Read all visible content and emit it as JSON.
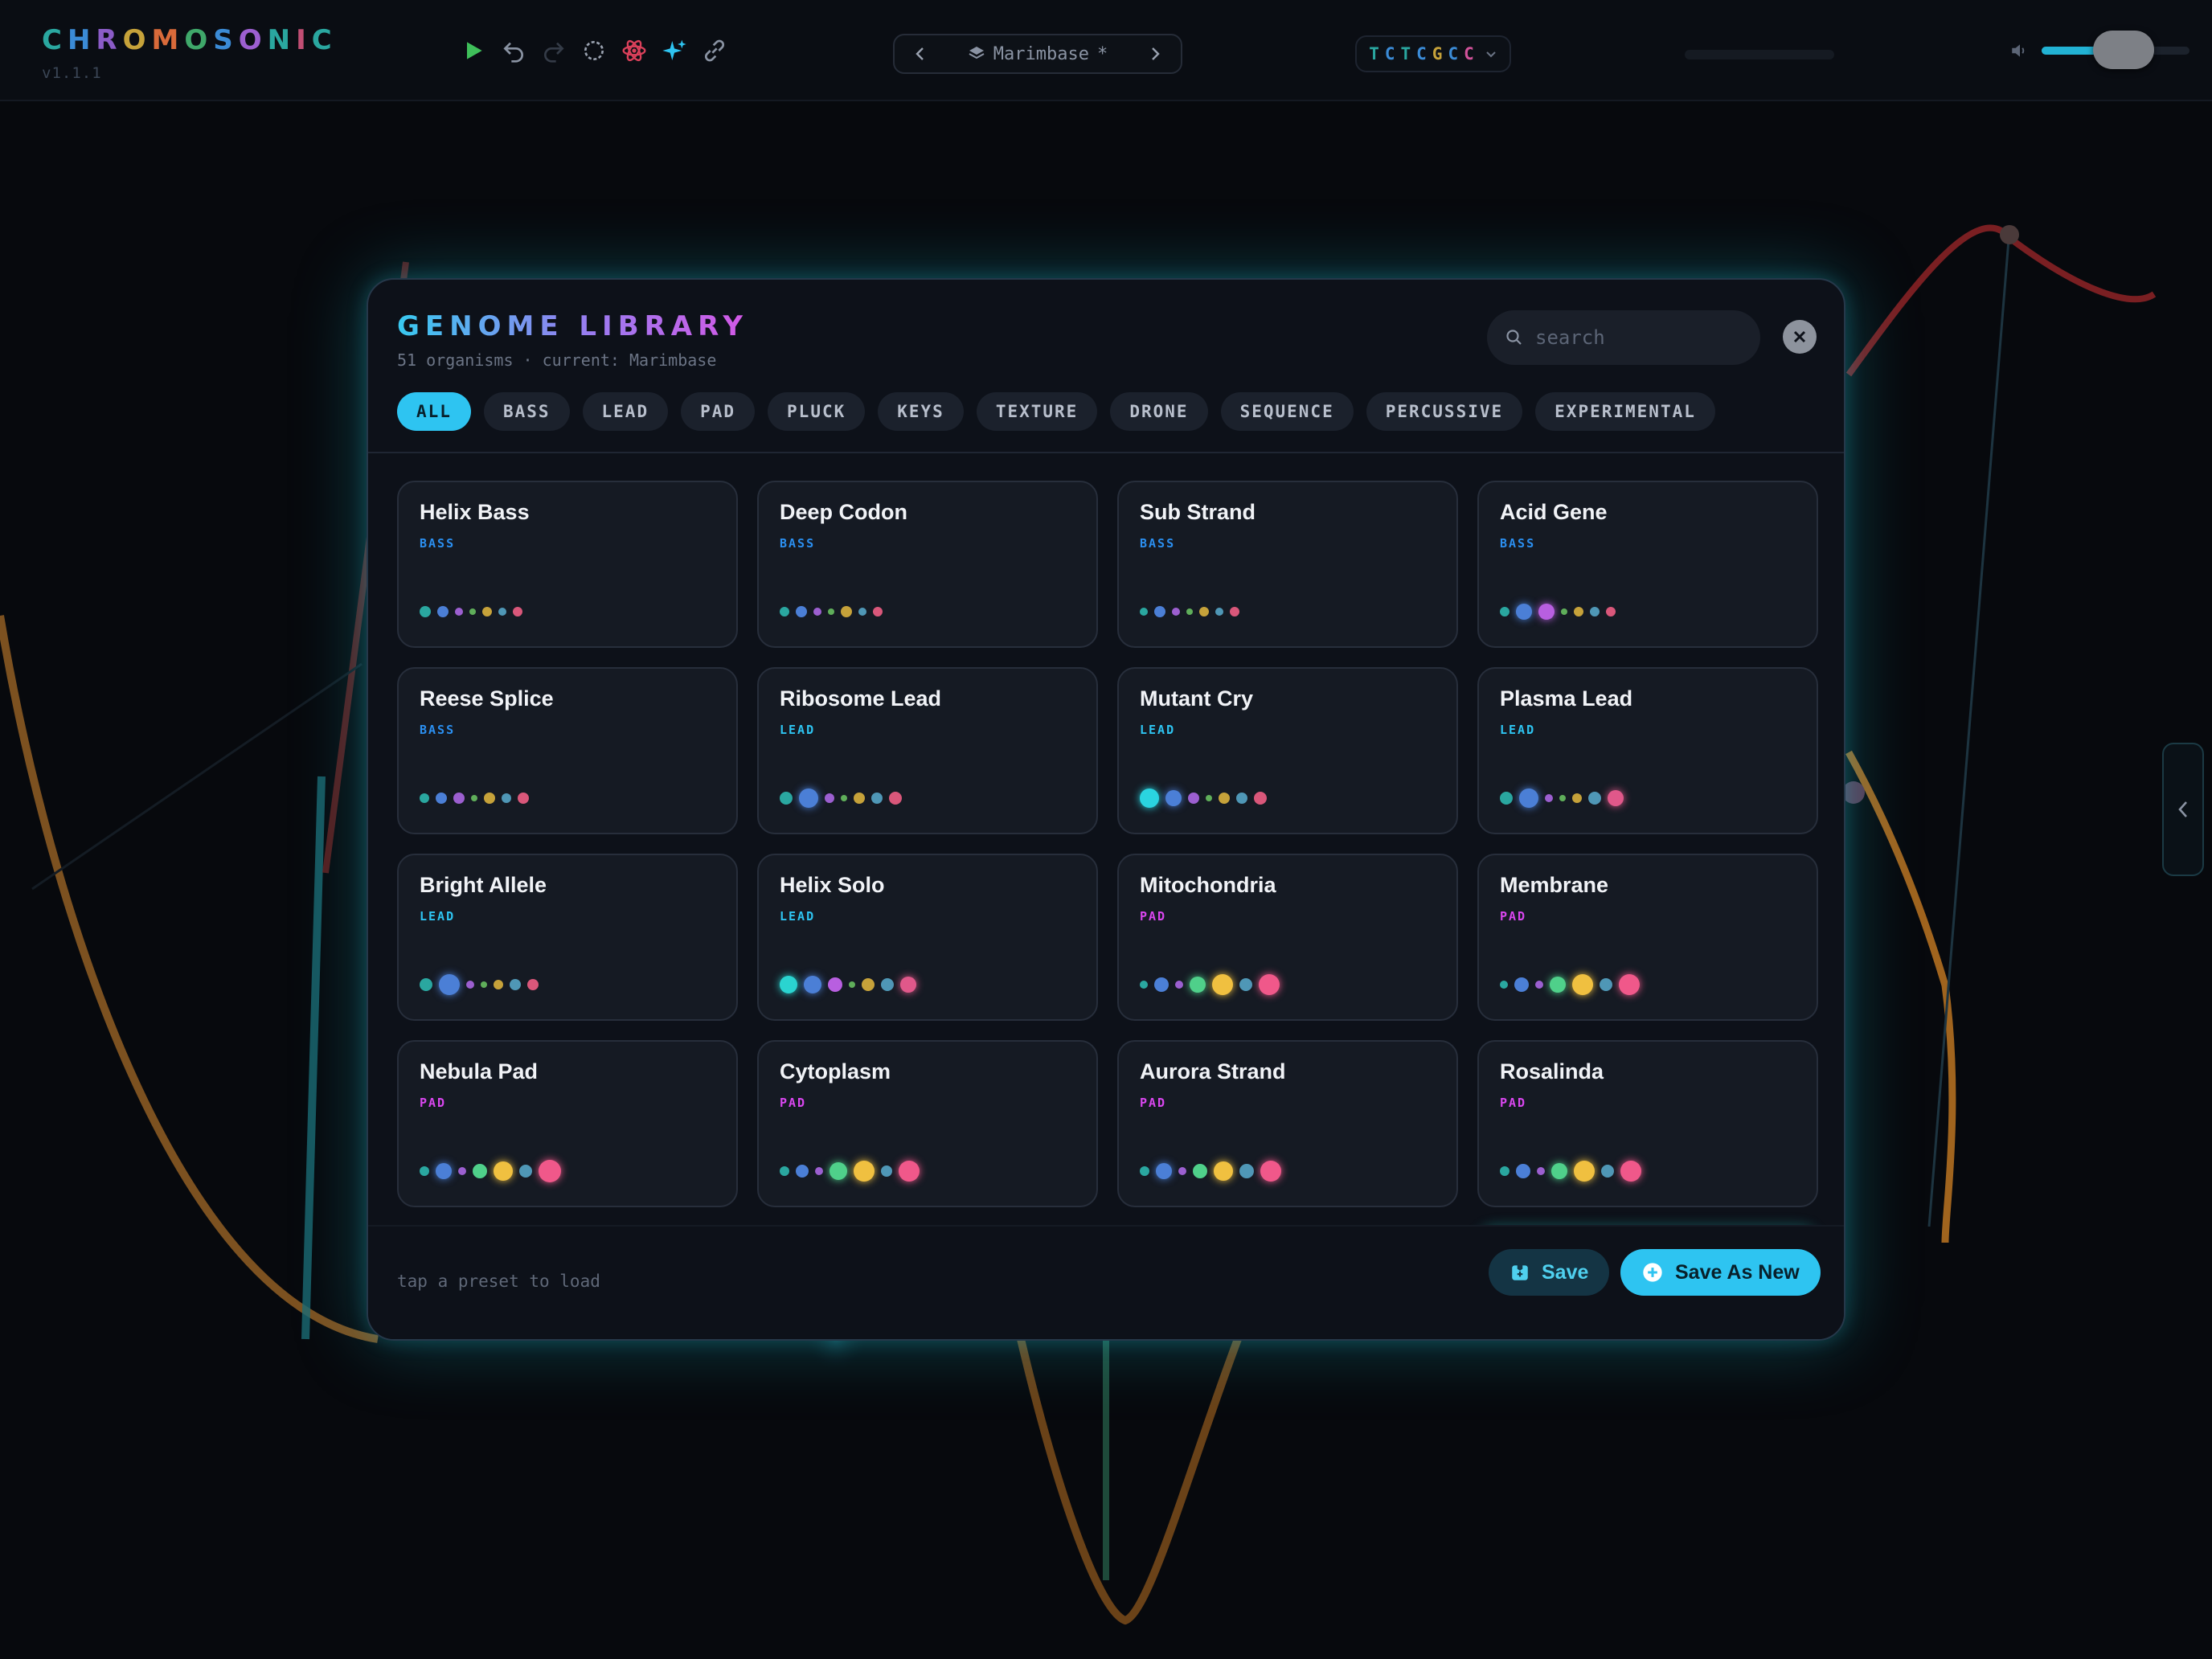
{
  "app": {
    "name_letters": [
      "C",
      "H",
      "R",
      "O",
      "M",
      "O",
      "S",
      "O",
      "N",
      "I",
      "C"
    ],
    "name_colors": [
      "#2aa7a0",
      "#3b8bd6",
      "#8b5cc7",
      "#c6a23a",
      "#d96a3a",
      "#3fa86a",
      "#3b8bd6",
      "#9c5fd0",
      "#2aa7a0",
      "#c24e74",
      "#2aa7a0"
    ],
    "version": "v1.1.1"
  },
  "toolbar": {
    "icons": [
      "play-icon",
      "undo-icon",
      "redo-icon",
      "loop-icon",
      "atom-icon",
      "sparkle-icon",
      "link-icon"
    ]
  },
  "preset_nav": {
    "name": "Marimbase",
    "modified_mark": "*"
  },
  "sequence": {
    "letters": [
      "T",
      "C",
      "T",
      "C",
      "G",
      "C",
      "C"
    ],
    "colors": [
      "#2aa7a0",
      "#3b8bd6",
      "#2aa7a0",
      "#3b8bd6",
      "#c6a23a",
      "#3b8bd6",
      "#d0529a"
    ]
  },
  "volume": {
    "level": 0.35
  },
  "library": {
    "title": "GENOME LIBRARY",
    "subtitle": "51 organisms · current: Marimbase",
    "search_placeholder": "search",
    "filters": [
      "ALL",
      "BASS",
      "LEAD",
      "PAD",
      "PLUCK",
      "KEYS",
      "TEXTURE",
      "DRONE",
      "SEQUENCE",
      "PERCUSSIVE",
      "EXPERIMENTAL"
    ],
    "active_filter": "ALL",
    "category_colors": {
      "BASS": "#2b8ff0",
      "LEAD": "#2ec4f1",
      "PAD": "#d946ef"
    },
    "presets": [
      {
        "name": "Helix Bass",
        "category": "BASS",
        "dots": [
          {
            "c": "#2aa7a0",
            "s": 14
          },
          {
            "c": "#4b7fd6",
            "s": 14
          },
          {
            "c": "#9c5fd0",
            "s": 10
          },
          {
            "c": "#5fae5a",
            "s": 8
          },
          {
            "c": "#c6a23a",
            "s": 12
          },
          {
            "c": "#4f97b6",
            "s": 10
          },
          {
            "c": "#d9577a",
            "s": 12
          }
        ]
      },
      {
        "name": "Deep Codon",
        "category": "BASS",
        "dots": [
          {
            "c": "#2aa7a0",
            "s": 12
          },
          {
            "c": "#4b7fd6",
            "s": 14
          },
          {
            "c": "#9c5fd0",
            "s": 10
          },
          {
            "c": "#5fae5a",
            "s": 8
          },
          {
            "c": "#c6a23a",
            "s": 14
          },
          {
            "c": "#4f97b6",
            "s": 10
          },
          {
            "c": "#d9577a",
            "s": 12
          }
        ]
      },
      {
        "name": "Sub Strand",
        "category": "BASS",
        "dots": [
          {
            "c": "#2aa7a0",
            "s": 10
          },
          {
            "c": "#4b7fd6",
            "s": 14
          },
          {
            "c": "#9c5fd0",
            "s": 10
          },
          {
            "c": "#5fae5a",
            "s": 8
          },
          {
            "c": "#c6a23a",
            "s": 12
          },
          {
            "c": "#4f97b6",
            "s": 10
          },
          {
            "c": "#d9577a",
            "s": 12
          }
        ]
      },
      {
        "name": "Acid Gene",
        "category": "BASS",
        "dots": [
          {
            "c": "#2aa7a0",
            "s": 12
          },
          {
            "c": "#4b7fd6",
            "s": 20
          },
          {
            "c": "#b85fe0",
            "s": 20
          },
          {
            "c": "#5fae5a",
            "s": 8
          },
          {
            "c": "#c6a23a",
            "s": 12
          },
          {
            "c": "#4f97b6",
            "s": 12
          },
          {
            "c": "#d9577a",
            "s": 12
          }
        ]
      },
      {
        "name": "Reese Splice",
        "category": "BASS",
        "dots": [
          {
            "c": "#2aa7a0",
            "s": 12
          },
          {
            "c": "#4b7fd6",
            "s": 14
          },
          {
            "c": "#9c5fd0",
            "s": 14
          },
          {
            "c": "#5fae5a",
            "s": 8
          },
          {
            "c": "#c6a23a",
            "s": 14
          },
          {
            "c": "#4f97b6",
            "s": 12
          },
          {
            "c": "#d9577a",
            "s": 14
          }
        ]
      },
      {
        "name": "Ribosome Lead",
        "category": "LEAD",
        "dots": [
          {
            "c": "#2aa7a0",
            "s": 16
          },
          {
            "c": "#4b7fd6",
            "s": 24
          },
          {
            "c": "#9c5fd0",
            "s": 12
          },
          {
            "c": "#5fae5a",
            "s": 8
          },
          {
            "c": "#c6a23a",
            "s": 14
          },
          {
            "c": "#4f97b6",
            "s": 14
          },
          {
            "c": "#d9577a",
            "s": 16
          }
        ]
      },
      {
        "name": "Mutant Cry",
        "category": "LEAD",
        "dots": [
          {
            "c": "#2ad4e0",
            "s": 24
          },
          {
            "c": "#4b7fd6",
            "s": 20
          },
          {
            "c": "#9c5fd0",
            "s": 14
          },
          {
            "c": "#5fae5a",
            "s": 8
          },
          {
            "c": "#c6a23a",
            "s": 14
          },
          {
            "c": "#4f97b6",
            "s": 14
          },
          {
            "c": "#d9577a",
            "s": 16
          }
        ]
      },
      {
        "name": "Plasma Lead",
        "category": "LEAD",
        "dots": [
          {
            "c": "#2aa7a0",
            "s": 16
          },
          {
            "c": "#4b7fd6",
            "s": 24
          },
          {
            "c": "#9c5fd0",
            "s": 10
          },
          {
            "c": "#5fae5a",
            "s": 8
          },
          {
            "c": "#c6a23a",
            "s": 12
          },
          {
            "c": "#4f97b6",
            "s": 16
          },
          {
            "c": "#e0588a",
            "s": 20
          }
        ]
      },
      {
        "name": "Bright Allele",
        "category": "LEAD",
        "dots": [
          {
            "c": "#2aa7a0",
            "s": 16
          },
          {
            "c": "#4b7fd6",
            "s": 26
          },
          {
            "c": "#9c5fd0",
            "s": 10
          },
          {
            "c": "#5fae5a",
            "s": 8
          },
          {
            "c": "#c6a23a",
            "s": 12
          },
          {
            "c": "#4f97b6",
            "s": 14
          },
          {
            "c": "#d9577a",
            "s": 14
          }
        ]
      },
      {
        "name": "Helix Solo",
        "category": "LEAD",
        "dots": [
          {
            "c": "#2ad4d0",
            "s": 22
          },
          {
            "c": "#4b7fd6",
            "s": 22
          },
          {
            "c": "#b85fe0",
            "s": 18
          },
          {
            "c": "#5fae5a",
            "s": 8
          },
          {
            "c": "#c6a23a",
            "s": 16
          },
          {
            "c": "#4f97b6",
            "s": 16
          },
          {
            "c": "#e0588a",
            "s": 20
          }
        ]
      },
      {
        "name": "Mitochondria",
        "category": "PAD",
        "dots": [
          {
            "c": "#2aa7a0",
            "s": 10
          },
          {
            "c": "#4b7fd6",
            "s": 18
          },
          {
            "c": "#9c5fd0",
            "s": 10
          },
          {
            "c": "#4fd08a",
            "s": 20
          },
          {
            "c": "#f0c040",
            "s": 26
          },
          {
            "c": "#4f97b6",
            "s": 16
          },
          {
            "c": "#f0588a",
            "s": 26
          }
        ]
      },
      {
        "name": "Membrane",
        "category": "PAD",
        "dots": [
          {
            "c": "#2aa7a0",
            "s": 10
          },
          {
            "c": "#4b7fd6",
            "s": 18
          },
          {
            "c": "#9c5fd0",
            "s": 10
          },
          {
            "c": "#4fd08a",
            "s": 20
          },
          {
            "c": "#f0c040",
            "s": 26
          },
          {
            "c": "#4f97b6",
            "s": 16
          },
          {
            "c": "#f0588a",
            "s": 26
          }
        ]
      },
      {
        "name": "Nebula Pad",
        "category": "PAD",
        "dots": [
          {
            "c": "#2aa7a0",
            "s": 12
          },
          {
            "c": "#4b7fd6",
            "s": 20
          },
          {
            "c": "#9c5fd0",
            "s": 10
          },
          {
            "c": "#4fd08a",
            "s": 18
          },
          {
            "c": "#f0c040",
            "s": 24
          },
          {
            "c": "#4f97b6",
            "s": 16
          },
          {
            "c": "#f0588a",
            "s": 28
          }
        ]
      },
      {
        "name": "Cytoplasm",
        "category": "PAD",
        "dots": [
          {
            "c": "#2aa7a0",
            "s": 12
          },
          {
            "c": "#4b7fd6",
            "s": 16
          },
          {
            "c": "#9c5fd0",
            "s": 10
          },
          {
            "c": "#4fd08a",
            "s": 22
          },
          {
            "c": "#f0c040",
            "s": 26
          },
          {
            "c": "#4f97b6",
            "s": 14
          },
          {
            "c": "#f0588a",
            "s": 26
          }
        ]
      },
      {
        "name": "Aurora Strand",
        "category": "PAD",
        "dots": [
          {
            "c": "#2aa7a0",
            "s": 12
          },
          {
            "c": "#4b7fd6",
            "s": 20
          },
          {
            "c": "#9c5fd0",
            "s": 10
          },
          {
            "c": "#4fd08a",
            "s": 18
          },
          {
            "c": "#f0c040",
            "s": 24
          },
          {
            "c": "#4f97b6",
            "s": 18
          },
          {
            "c": "#f0588a",
            "s": 26
          }
        ]
      },
      {
        "name": "Rosalinda",
        "category": "PAD",
        "dots": [
          {
            "c": "#2aa7a0",
            "s": 12
          },
          {
            "c": "#4b7fd6",
            "s": 18
          },
          {
            "c": "#9c5fd0",
            "s": 10
          },
          {
            "c": "#4fd08a",
            "s": 20
          },
          {
            "c": "#f0c040",
            "s": 26
          },
          {
            "c": "#4f97b6",
            "s": 16
          },
          {
            "c": "#f0588a",
            "s": 26
          }
        ]
      },
      {
        "name": "",
        "category": "",
        "dots": []
      },
      {
        "name": "",
        "category": "",
        "dots": []
      },
      {
        "name": "",
        "category": "",
        "dots": []
      },
      {
        "name": "",
        "category": "",
        "dots": [],
        "selected": true
      }
    ],
    "hint": "tap a preset to load",
    "save_label": "Save",
    "save_new_label": "Save As New"
  }
}
